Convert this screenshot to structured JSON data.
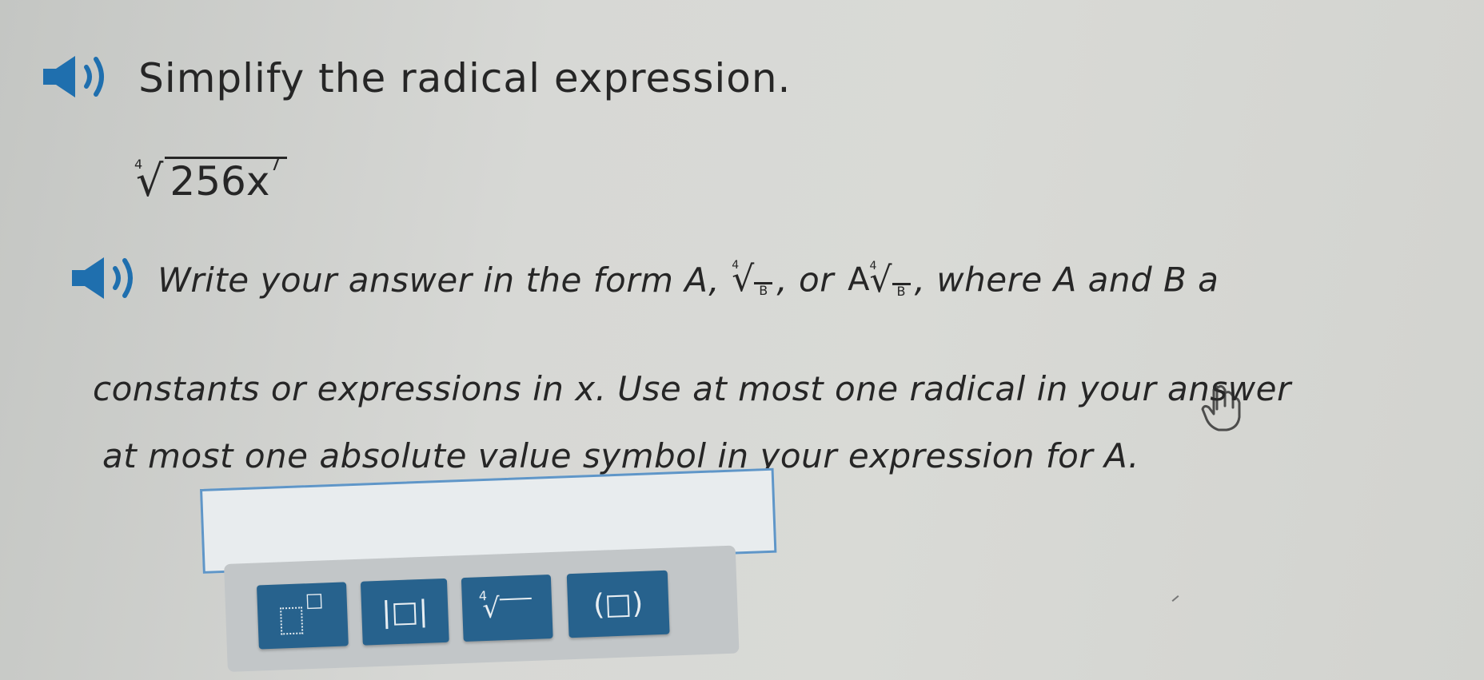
{
  "question": {
    "prompt": "Simplify the radical expression.",
    "expression": {
      "index": "4",
      "radicand": "256x",
      "exponent": "7"
    }
  },
  "instructions": {
    "line1_part1": "Write your answer in the form A,",
    "form2_radicand": "B",
    "form2_index": "4",
    "or_text": ", or",
    "form3_coef": "A",
    "form3_index": "4",
    "form3_radicand": "B",
    "line1_part2": ", where A and B a",
    "line2": "constants or expressions in x. Use at most one radical in your answer",
    "line3": "at most one absolute value symbol in your expression for A."
  },
  "toolbar": {
    "buttons": [
      {
        "name": "exponent-button",
        "label": "□",
        "icon": "superscript-template"
      },
      {
        "name": "absolute-value-button",
        "label": "|□|",
        "icon": "absolute-value-template"
      },
      {
        "name": "fourth-root-button",
        "label": "√",
        "index": "4",
        "icon": "radical-template"
      },
      {
        "name": "parentheses-button",
        "label": "(□)",
        "icon": "parentheses-template"
      }
    ]
  },
  "colors": {
    "accent": "#27628d",
    "input_border": "#5f96c8",
    "text": "#262626"
  }
}
